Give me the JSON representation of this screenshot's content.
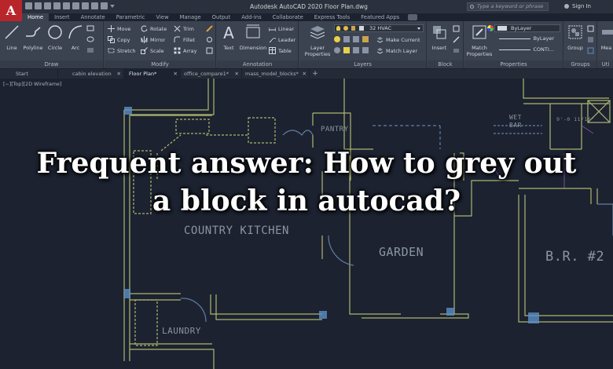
{
  "app": {
    "logo_letter": "A",
    "window_title": "Autodesk AutoCAD 2020   Floor Plan.dwg",
    "search_placeholder": "Type a keyword or phrase",
    "signin": "Sign In"
  },
  "ribbon_tabs": [
    "Home",
    "Insert",
    "Annotate",
    "Parametric",
    "View",
    "Manage",
    "Output",
    "Add-ins",
    "Collaborate",
    "Express Tools",
    "Featured Apps"
  ],
  "draw_panel": {
    "title": "Draw",
    "tools": [
      "Line",
      "Polyline",
      "Circle",
      "Arc"
    ]
  },
  "modify_panel": {
    "title": "Modify",
    "tools": [
      "Move",
      "Rotate",
      "Trim",
      "Copy",
      "Mirror",
      "Fillet",
      "Stretch",
      "Scale",
      "Array"
    ]
  },
  "annotation_panel": {
    "title": "Annotation",
    "tools": [
      "Text",
      "Dimension",
      "Linear",
      "Leader",
      "Table"
    ]
  },
  "layers_panel": {
    "title": "Layers",
    "layer_properties": "Layer Properties",
    "current_layer": "32 HVAC",
    "make_current": "Make Current",
    "match_layer": "Match Layer"
  },
  "block_panel": {
    "title": "Block",
    "insert": "Insert"
  },
  "properties_panel": {
    "title": "Properties",
    "match_properties": "Match Properties",
    "color": "ByLayer",
    "lineweight": "ByLayer",
    "linetype": "CONTI..."
  },
  "groups_panel": {
    "title": "Groups",
    "group": "Group"
  },
  "utilities_panel": {
    "title": "Uti",
    "measure": "Mea"
  },
  "file_tabs": [
    "Start",
    "cabin elevation",
    "Floor Plan*",
    "office_compare1*",
    "mass_model_blocks*"
  ],
  "viewport_label": "[−][Top][2D Wireframe]",
  "room_labels": {
    "pantry": "PANTRY",
    "kitchen": "COUNTRY KITCHEN",
    "garden": "GARDEN",
    "br2": "B.R. #2",
    "laundry": "LAUNDRY",
    "wet_bar_1": "WET",
    "wet_bar_2": "BAR",
    "dim": "9'-0 11/16\""
  },
  "headline": {
    "line1": "Frequent answer: How to grey out",
    "line2": "a block in autocad?"
  },
  "colors": {
    "wall": "#c7d07a",
    "wall_accent": "#5d8fc4",
    "background": "#1c2230",
    "ribbon": "#3b4250",
    "logo": "#b8262b"
  }
}
